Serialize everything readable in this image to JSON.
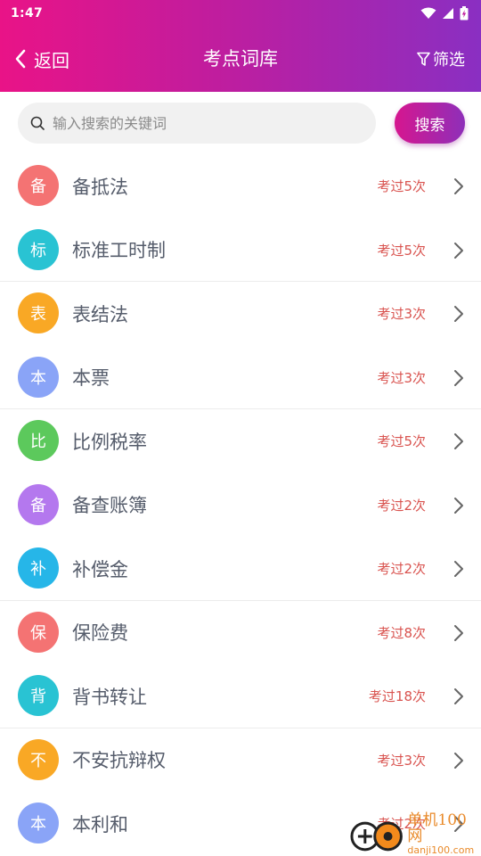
{
  "status_bar": {
    "time": "1:47",
    "icons": [
      "wifi-icon",
      "signal-icon",
      "battery-icon"
    ]
  },
  "header": {
    "back_label": "返回",
    "title": "考点词库",
    "filter_label": "筛选"
  },
  "search": {
    "placeholder": "输入搜索的关键词",
    "value": "",
    "button_label": "搜索"
  },
  "terms": [
    {
      "initial": "备",
      "name": "备抵法",
      "count": "考过5次",
      "color": "#f47373"
    },
    {
      "initial": "标",
      "name": "标准工时制",
      "count": "考过5次",
      "color": "#29c3d3"
    },
    {
      "initial": "表",
      "name": "表结法",
      "count": "考过3次",
      "color": "#f9a825"
    },
    {
      "initial": "本",
      "name": "本票",
      "count": "考过3次",
      "color": "#8aa4f7"
    },
    {
      "initial": "比",
      "name": "比例税率",
      "count": "考过5次",
      "color": "#5cc95c"
    },
    {
      "initial": "备",
      "name": "备查账簿",
      "count": "考过2次",
      "color": "#b478ee"
    },
    {
      "initial": "补",
      "name": "补偿金",
      "count": "考过2次",
      "color": "#26b6e8"
    },
    {
      "initial": "保",
      "name": "保险费",
      "count": "考过8次",
      "color": "#f47373"
    },
    {
      "initial": "背",
      "name": "背书转让",
      "count": "考过18次",
      "color": "#29c3d3"
    },
    {
      "initial": "不",
      "name": "不安抗辩权",
      "count": "考过3次",
      "color": "#f9a825"
    },
    {
      "initial": "本",
      "name": "本利和",
      "count": "考过2次",
      "color": "#8aa4f7"
    }
  ],
  "watermark": {
    "main": "单机100网",
    "sub": "danji100.com"
  }
}
